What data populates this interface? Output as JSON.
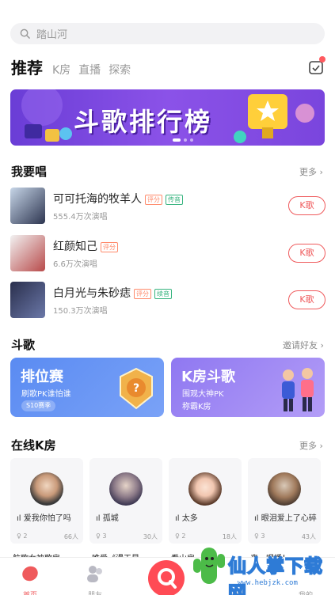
{
  "search": {
    "placeholder": "踏山河"
  },
  "tabs": [
    {
      "label": "推荐",
      "active": true
    },
    {
      "label": "K房"
    },
    {
      "label": "直播"
    },
    {
      "label": "探索"
    }
  ],
  "banner": {
    "title": "斗歌排行榜"
  },
  "sing_section": {
    "title": "我要唱",
    "more": "更多",
    "songs": [
      {
        "name": "可可托海的牧羊人",
        "tags": [
          "评分",
          "传音"
        ],
        "count": "555.4万次演唱",
        "button": "K歌"
      },
      {
        "name": "红颜知己",
        "tags": [
          "评分"
        ],
        "count": "6.6万次演唱",
        "button": "K歌"
      },
      {
        "name": "白月光与朱砂痣",
        "tags": [
          "评分",
          "续音"
        ],
        "count": "150.3万次演唱",
        "button": "K歌"
      }
    ]
  },
  "battle_section": {
    "title": "斗歌",
    "more": "邀请好友",
    "cards": [
      {
        "title": "排位赛",
        "sub": "刷歌PK谁怕谁",
        "badge": "S10赛季"
      },
      {
        "title": "K房斗歌",
        "sub": "围观大神PK",
        "sub2": "称霸K房"
      }
    ]
  },
  "rooms_section": {
    "title": "在线K房",
    "more": "更多",
    "rooms": [
      {
        "name": "爱我你怕了吗",
        "rank": "2",
        "people": "66人",
        "title": "航歌女神歌房"
      },
      {
        "name": "孤城",
        "rank": "3",
        "people": "30人",
        "title": "唯爱《漫天星"
      },
      {
        "name": "太多",
        "rank": "2",
        "people": "18人",
        "title": "看山房"
      },
      {
        "name": "眼泪爱上了心碎",
        "rank": "3",
        "people": "43人",
        "title": "来一唱播！"
      }
    ]
  },
  "tabbar": {
    "items": [
      {
        "label": "首页",
        "active": true
      },
      {
        "label": "朋友"
      },
      {
        "label": ""
      },
      {
        "label": "消息"
      },
      {
        "label": "我的"
      }
    ]
  },
  "watermark": {
    "text": "仙人掌下载网",
    "url": "www.hebjzk.com"
  },
  "colors": {
    "accent": "#ef5a5c",
    "banner": "#7a45dd",
    "card_blue": "#5b8cf0",
    "card_purple": "#9b7bf3"
  }
}
